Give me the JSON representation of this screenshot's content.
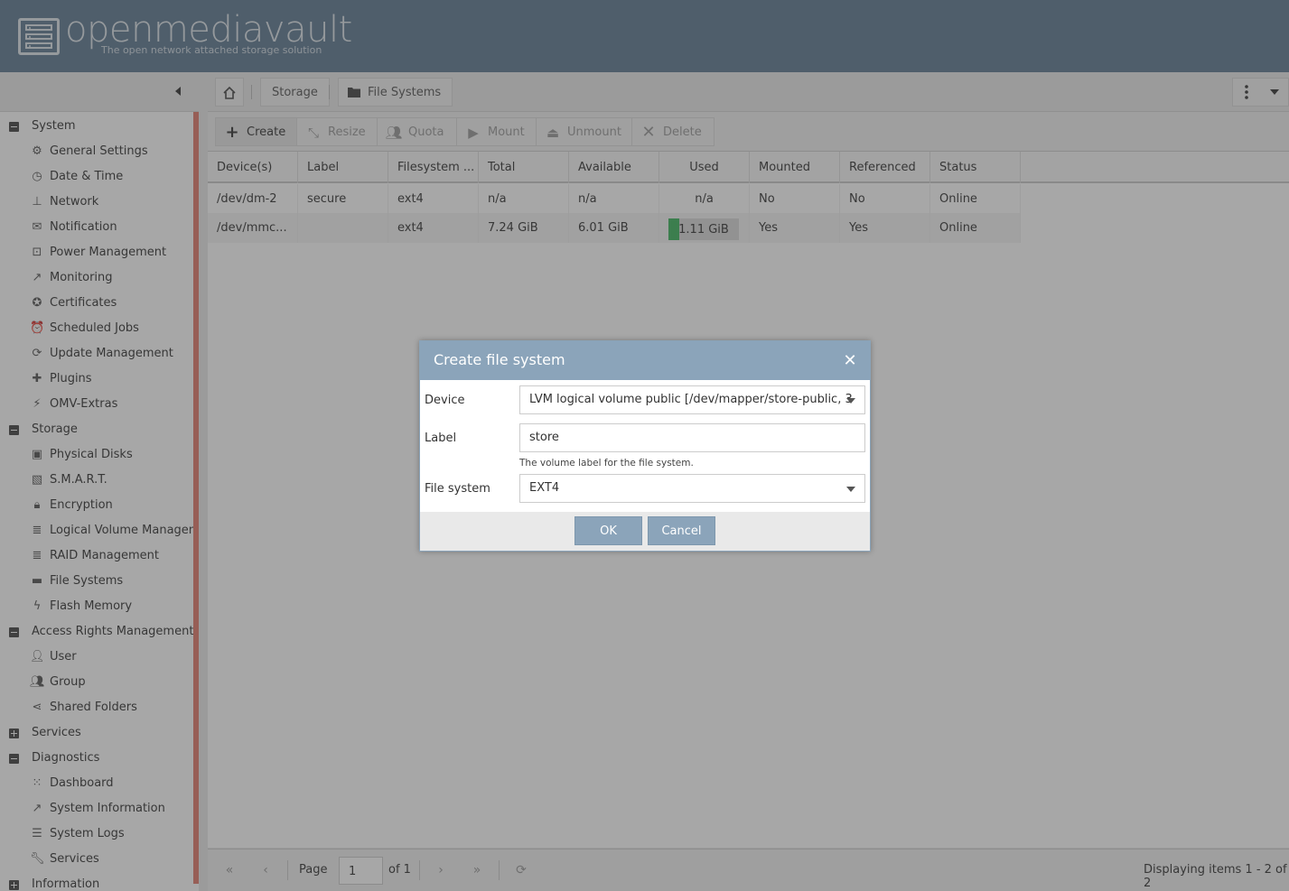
{
  "app": {
    "name": "openmediavault",
    "tagline": "The open network attached storage solution"
  },
  "breadcrumb": {
    "home_icon": "home-icon",
    "items": [
      "Storage",
      "File Systems"
    ]
  },
  "sidebar": {
    "groups": [
      {
        "label": "System",
        "expanded": true,
        "items": [
          {
            "label": "General Settings",
            "icon": "gears-icon"
          },
          {
            "label": "Date & Time",
            "icon": "clock-icon"
          },
          {
            "label": "Network",
            "icon": "network-icon"
          },
          {
            "label": "Notification",
            "icon": "envelope-icon"
          },
          {
            "label": "Power Management",
            "icon": "power-icon"
          },
          {
            "label": "Monitoring",
            "icon": "line-chart-icon"
          },
          {
            "label": "Certificates",
            "icon": "certificate-icon"
          },
          {
            "label": "Scheduled Jobs",
            "icon": "alarm-clock-icon"
          },
          {
            "label": "Update Management",
            "icon": "update-icon"
          },
          {
            "label": "Plugins",
            "icon": "puzzle-icon"
          },
          {
            "label": "OMV-Extras",
            "icon": "plug-icon"
          }
        ]
      },
      {
        "label": "Storage",
        "expanded": true,
        "items": [
          {
            "label": "Physical Disks",
            "icon": "disk-icon"
          },
          {
            "label": "S.M.A.R.T.",
            "icon": "smart-icon"
          },
          {
            "label": "Encryption",
            "icon": "lock-icon"
          },
          {
            "label": "Logical Volume Managem",
            "icon": "database-icon"
          },
          {
            "label": "RAID Management",
            "icon": "database-icon"
          },
          {
            "label": "File Systems",
            "icon": "folder-icon"
          },
          {
            "label": "Flash Memory",
            "icon": "flash-icon"
          }
        ]
      },
      {
        "label": "Access Rights Management",
        "expanded": true,
        "items": [
          {
            "label": "User",
            "icon": "user-icon"
          },
          {
            "label": "Group",
            "icon": "group-icon"
          },
          {
            "label": "Shared Folders",
            "icon": "share-icon"
          }
        ]
      },
      {
        "label": "Services",
        "expanded": false,
        "items": []
      },
      {
        "label": "Diagnostics",
        "expanded": true,
        "items": [
          {
            "label": "Dashboard",
            "icon": "grid-icon"
          },
          {
            "label": "System Information",
            "icon": "line-chart-icon"
          },
          {
            "label": "System Logs",
            "icon": "list-icon"
          },
          {
            "label": "Services",
            "icon": "wrench-icon"
          }
        ]
      },
      {
        "label": "Information",
        "expanded": false,
        "items": []
      }
    ]
  },
  "toolbar": {
    "create": "Create",
    "resize": "Resize",
    "quota": "Quota",
    "mount": "Mount",
    "unmount": "Unmount",
    "delete": "Delete"
  },
  "grid": {
    "columns": [
      "Device(s)",
      "Label",
      "Filesystem ...",
      "Total",
      "Available",
      "Used",
      "Mounted",
      "Referenced",
      "Status"
    ],
    "rows": [
      {
        "device": "/dev/dm-2",
        "label": "secure",
        "fs": "ext4",
        "total": "n/a",
        "available": "n/a",
        "used": "n/a",
        "used_fraction": null,
        "mounted": "No",
        "referenced": "No",
        "status": "Online"
      },
      {
        "device": "/dev/mmc...",
        "label": "",
        "fs": "ext4",
        "total": "7.24 GiB",
        "available": "6.01 GiB",
        "used": "1.11 GiB",
        "used_fraction": 0.15,
        "mounted": "Yes",
        "referenced": "Yes",
        "status": "Online"
      }
    ]
  },
  "pager": {
    "page_label": "Page",
    "page_value": "1",
    "of_label": "of 1",
    "display_text": "Displaying items 1 - 2 of 2"
  },
  "dialog": {
    "title": "Create file system",
    "device_label": "Device",
    "device_value": "LVM logical volume public [/dev/mapper/store-public, 3",
    "label_label": "Label",
    "label_value": "store",
    "label_help": "The volume label for the file system.",
    "fs_label": "File system",
    "fs_value": "EXT4",
    "ok": "OK",
    "cancel": "Cancel"
  },
  "colors": {
    "header": "#5f7b93",
    "dialog_header": "#8ba4ba",
    "used_bar": "#3cb55e",
    "sidebar_scrollbar": "#e27b6c"
  }
}
